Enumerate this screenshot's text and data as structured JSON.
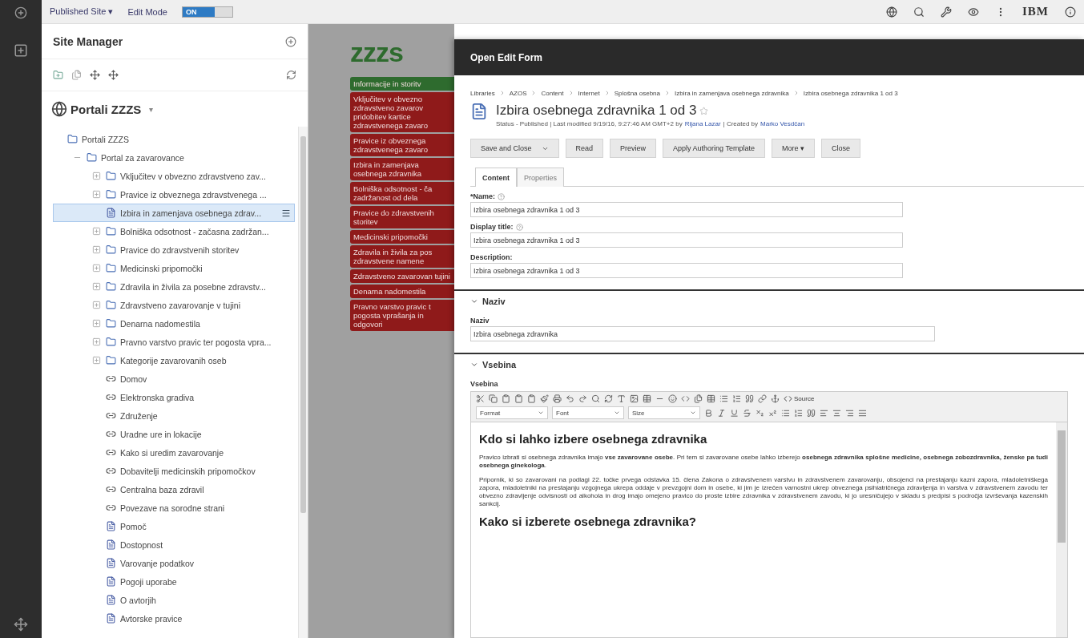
{
  "topbar": {
    "site_menu": "Published Site ▾",
    "edit_mode_label": "Edit Mode",
    "edit_mode": {
      "on": true,
      "label": "ON"
    },
    "brand": "IBM"
  },
  "site_manager": {
    "title": "Site Manager",
    "portal_title": "Portali ZZZS",
    "portal_caret": "▾",
    "tree": [
      {
        "label": "Portali ZZZS",
        "kind": "folder",
        "children": [
          {
            "label": "Portal za zavarovance",
            "kind": "folder",
            "expanded": true,
            "children": [
              {
                "label": "Vključitev v obvezno zdravstveno zav...",
                "kind": "folder",
                "expanded": false,
                "selected": false
              },
              {
                "label": "Pravice iz obveznega zdravstvenega ...",
                "kind": "folder",
                "expanded": false,
                "selected": false
              },
              {
                "label": "Izbira in zamenjava osebnega zdrav...",
                "kind": "page",
                "selected": true
              },
              {
                "label": "Bolniška odsotnost - začasna zadržan...",
                "kind": "folder",
                "expanded": false,
                "selected": false
              },
              {
                "label": "Pravice do zdravstvenih storitev",
                "kind": "folder",
                "expanded": false,
                "selected": false
              },
              {
                "label": "Medicinski pripomočki",
                "kind": "folder",
                "expanded": false,
                "selected": false
              },
              {
                "label": "Zdravila in živila za posebne zdravstv...",
                "kind": "folder",
                "expanded": false,
                "selected": false
              },
              {
                "label": "Zdravstveno zavarovanje v tujini",
                "kind": "folder",
                "expanded": false,
                "selected": false
              },
              {
                "label": "Denarna nadomestila",
                "kind": "folder",
                "expanded": false,
                "selected": false
              },
              {
                "label": "Pravno varstvo pravic ter pogosta vpra...",
                "kind": "folder",
                "expanded": false,
                "selected": false
              },
              {
                "label": "Kategorije zavarovanih oseb",
                "kind": "folder",
                "expanded": false,
                "selected": false
              },
              {
                "label": "Domov",
                "kind": "link",
                "selected": false
              },
              {
                "label": "Elektronska gradiva",
                "kind": "link",
                "selected": false
              },
              {
                "label": "Združenje",
                "kind": "link",
                "selected": false
              },
              {
                "label": "Uradne ure in lokacije",
                "kind": "link",
                "selected": false
              },
              {
                "label": "Kako si uredim zavarovanje",
                "kind": "link",
                "selected": false
              },
              {
                "label": "Dobavitelji medicinskih pripomočkov",
                "kind": "link",
                "selected": false
              },
              {
                "label": "Centralna baza zdravil",
                "kind": "link",
                "selected": false
              },
              {
                "label": "Povezave na sorodne strani",
                "kind": "link",
                "selected": false
              },
              {
                "label": "Pomoč",
                "kind": "page",
                "selected": false
              },
              {
                "label": "Dostopnost",
                "kind": "page",
                "selected": false
              },
              {
                "label": "Varovanje podatkov",
                "kind": "page",
                "selected": false
              },
              {
                "label": "Pogoji uporabe",
                "kind": "page",
                "selected": false
              },
              {
                "label": "O avtorjih",
                "kind": "page",
                "selected": false
              },
              {
                "label": "Avtorske pravice",
                "kind": "page",
                "selected": false
              }
            ]
          }
        ]
      }
    ]
  },
  "site_preview": {
    "logo": "zzzs",
    "nav": [
      {
        "label": "Informacije in storitv",
        "color": "#2e6b2e"
      },
      {
        "label": "Vključitev v obvezno zdravstveno zavarov pridobitev kartice zdravstvenega zavaro",
        "color": "#8f1a1a"
      },
      {
        "label": "Pravice iz obveznega zdravstvenega zavaro",
        "color": "#8f1a1a"
      },
      {
        "label": "Izbira in zamenjava osebnega zdravnika",
        "color": "#8f1a1a"
      },
      {
        "label": "Bolniška odsotnost - ča zadržanost od dela",
        "color": "#8f1a1a"
      },
      {
        "label": "Pravice do zdravstvenih storitev",
        "color": "#8f1a1a"
      },
      {
        "label": "Medicinski pripomočki",
        "color": "#8f1a1a"
      },
      {
        "label": "Zdravila in živila za pos zdravstvene namene",
        "color": "#8f1a1a"
      },
      {
        "label": "Zdravstveno zavarovan tujini",
        "color": "#8f1a1a"
      },
      {
        "label": "Denarna nadomestila",
        "color": "#8f1a1a"
      },
      {
        "label": "Pravno varstvo pravic t pogosta vprašanja in odgovori",
        "color": "#8f1a1a"
      }
    ]
  },
  "dialog": {
    "title": "Open Edit Form",
    "breadcrumb": [
      "Libraries",
      "AZOS",
      "Content",
      "Internet",
      "Splošna osebna",
      "Izbira in zamenjava osebnega zdravnika",
      "Izbira osebnega zdravnika 1 od 3"
    ],
    "item_title": "Izbira osebnega zdravnika 1 od 3",
    "favorite": false,
    "status": {
      "prefix": "Status - Published | Last modified 9/19/16, 9:27:46 AM GMT+2 by",
      "modified_by": "Rijana Lazar",
      "middle": "| Created by",
      "created_by": "Marko Vesdčan"
    },
    "buttons": [
      {
        "label": "Save and Close",
        "kind": "split"
      },
      {
        "label": "Read",
        "kind": "plain"
      },
      {
        "label": "Preview",
        "kind": "plain"
      },
      {
        "label": "Apply Authoring Template",
        "kind": "plain"
      },
      {
        "label": "More ▾",
        "kind": "plain"
      },
      {
        "label": "Close",
        "kind": "plain"
      }
    ],
    "tabs": [
      {
        "label": "Content",
        "selected": true
      },
      {
        "label": "Properties",
        "selected": false
      }
    ],
    "fields": [
      {
        "label": "*Name:",
        "help": true,
        "value": "Izbira osebnega zdravnika 1 od 3"
      },
      {
        "label": "Display title:",
        "help": true,
        "value": "Izbira osebnega zdravnika 1 od 3"
      },
      {
        "label": "Description:",
        "help": false,
        "value": "Izbira osebnega zdravnika 1 od 3"
      }
    ],
    "sections": [
      {
        "title": "Naziv",
        "expanded": true,
        "field_label": "Naziv",
        "value": "Izbira osebnega zdravnika"
      },
      {
        "title": "Vsebina",
        "expanded": true,
        "field_label": "Vsebina"
      }
    ],
    "editor": {
      "source_label": "Source",
      "dropdowns": [
        "Format",
        "Font",
        "Size"
      ],
      "content": [
        {
          "kind": "heading",
          "text": "Kdo si lahko izbere osebnega zdravnika"
        },
        {
          "kind": "paragraph",
          "text": "Pravico izbrati si osebnega zdravnika imajo **vse zavarovane osebe**. Pri tem si zavarovane osebe lahko izberejo **osebnega zdravnika splošne medicine, osebnega zobozdravnika, ženske pa tudi osebnega ginekologa**."
        },
        {
          "kind": "paragraph",
          "text": "Pripornik, ki so zavarovani na podlagi 22. točke prvega odstavka 15. člena Zakona o zdravstvenem varstvu in zdravstvenem zavarovanju, obsojenci na prestajanju kazni zapora, mladoletniškega zapora, mladoletniki na prestajanju vzgojnega ukrepa oddaje v prevzgojni dom in osebe, ki jim je izrečen varnostni ukrep obveznega psihiatričnega zdravljenja in varstva v zdravstvenem zavodu ter obvezno zdravljenje odvisnosti od alkohola in drog imajo omejeno pravico do proste izbire zdravnika v zdravstvenem zavodu, ki jo uresničujejo v skladu s predpisi s področja izvrševanja kazenskih sankcij."
        },
        {
          "kind": "heading",
          "text": "Kako si izberete osebnega zdravnika?"
        }
      ]
    }
  }
}
